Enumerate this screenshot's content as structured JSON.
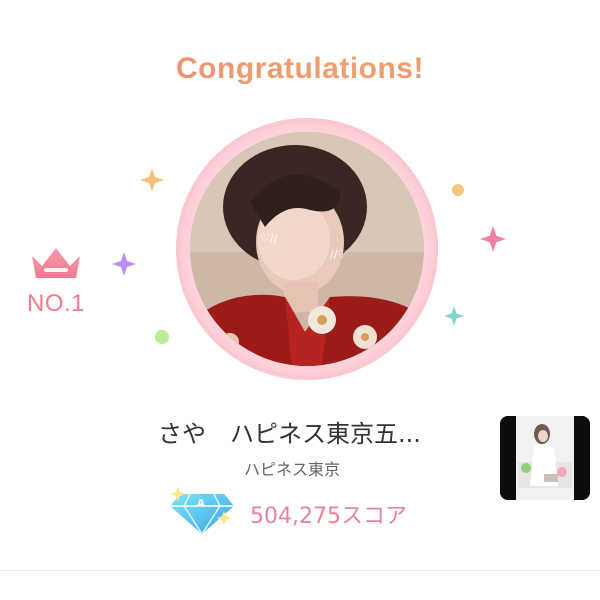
{
  "header": {
    "title": "Congratulations!"
  },
  "rank": {
    "label": "NO.1",
    "icon": "crown-icon",
    "color": "#ef7c8e"
  },
  "profile": {
    "name": "さや　ハピネス東京五...",
    "shop": "ハピネス東京",
    "score": "504,275スコア",
    "score_icon": "diamond-icon"
  },
  "colors": {
    "accent_pink": "#f7a7b8",
    "title_gradient_start": "#e9897d",
    "title_gradient_end": "#f0a06a",
    "score_pink": "#e7849b"
  }
}
